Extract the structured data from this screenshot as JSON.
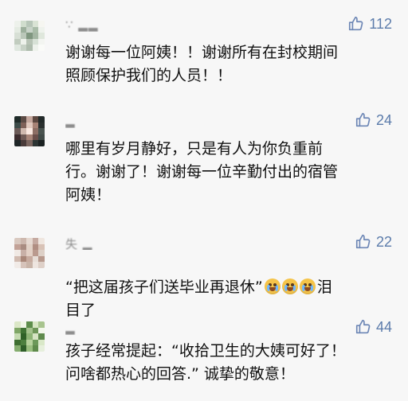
{
  "comments": [
    {
      "username": "∵ ▂▂",
      "likes": "112",
      "text": "谢谢每一位阿姨！！谢谢所有在封校期间\n照顾保护我们的人员！！",
      "avatar_colors": [
        "#edf1eb",
        "#d0ddcd",
        "#b7c6b8",
        "#d9e3d4",
        "#f6f6f1",
        "#e4ebe2",
        "#9db09d",
        "#c8d3c8",
        "#a9bca8",
        "#eef2ec",
        "#d7dfd5",
        "#bac7b9",
        "#7f967f",
        "#a4b6a3",
        "#dfe7dc",
        "#c1ccbf",
        "#edf2eb",
        "#b7c3b5",
        "#d7e1d6",
        "#f3f5f1",
        "#dfe7df",
        "#c7d2c6",
        "#aebcad",
        "#eef2ec",
        "#fafbf8"
      ]
    },
    {
      "username": "▂",
      "likes": "24",
      "text": "哪里有岁月静好，只是有人为你负重前\n行。谢谢了！谢谢每一位辛勤付出的宿管\n阿姨！",
      "avatar_colors": [
        "#1f2b29",
        "#5b4a44",
        "#c5a79d",
        "#5d4840",
        "#222a29",
        "#3d4c4a",
        "#7f6158",
        "#e1c8bd",
        "#a78275",
        "#2a302f",
        "#6c5b58",
        "#d0b9ae",
        "#fbe9e1",
        "#8d6e64",
        "#49534f",
        "#3c2c2e",
        "#6f5a55",
        "#a88578",
        "#6a4e49",
        "#404a47",
        "#1e2627",
        "#493b3a",
        "#7b6660",
        "#2c3534",
        "#1b2222"
      ]
    },
    {
      "username": "失 ▂",
      "likes": "22",
      "text_before": "“把这届孩子们送毕业再退休”",
      "text_after": "泪\n目了",
      "emoji_label": "crying-face emoji",
      "avatar_colors": [
        "#d9c9c0",
        "#cdb8ae",
        "#e6d9d1",
        "#c5aaa1",
        "#efe6df",
        "#c2a297",
        "#a98c81",
        "#e1d1c6",
        "#b08e82",
        "#d8c2b6",
        "#f0e9e4",
        "#c8b0a7",
        "#e3d0c5",
        "#ba9a8e",
        "#ddd0c7",
        "#d1bbb0",
        "#a98779",
        "#c7ab9f",
        "#e7ddd6",
        "#b7998d",
        "#f1ebe7",
        "#d6c3ba",
        "#c9b4a8",
        "#eee5df",
        "#ded0c8"
      ]
    },
    {
      "username": "▂",
      "likes": "44",
      "text": "孩子经常提起：“收拾卫生的大姨可好了！\n问啥都热心的回答.”     诚挚的敬意！",
      "avatar_colors": [
        "#dbe7c7",
        "#f0f6e6",
        "#5d8d4b",
        "#d8e6c4",
        "#a8c48e",
        "#7fa666",
        "#3f7333",
        "#a5c38d",
        "#6e9658",
        "#f2f7ea",
        "#c4dab0",
        "#2f6127",
        "#8db475",
        "#d6e4c3",
        "#5f8b4d",
        "#3e6e31",
        "#4d803f",
        "#b7d29d",
        "#6c9859",
        "#d9e8c8",
        "#85ad6f",
        "#2f5f29",
        "#9abf80",
        "#5e8a4b",
        "#e6efdc"
      ]
    }
  ]
}
